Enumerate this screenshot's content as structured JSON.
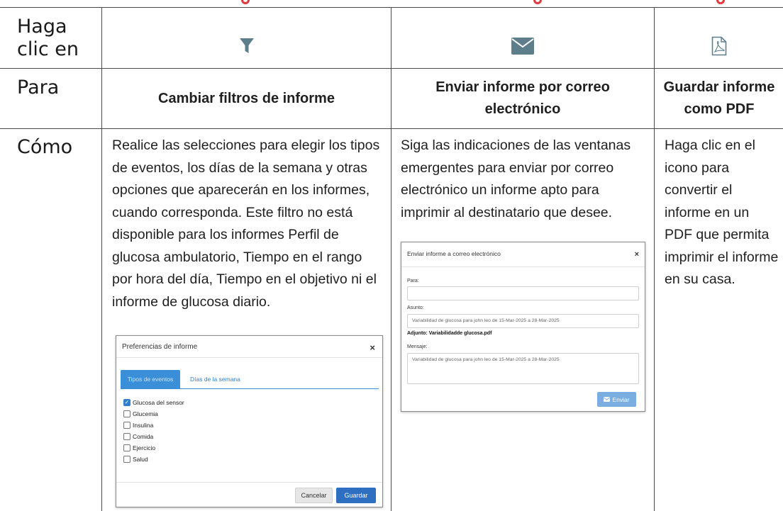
{
  "rows": {
    "click": "Haga clic en",
    "purpose": "Para",
    "how": "Cómo"
  },
  "icons": {
    "col1": "filter-icon",
    "col2": "envelope-icon",
    "col3": "pdf-file-icon",
    "color": "#5f7e8c",
    "accent": "#e03a3e"
  },
  "purposes": {
    "col1": "Cambiar filtros de informe",
    "col2": "Enviar informe por correo electrónico",
    "col3": "Guardar informe como PDF"
  },
  "howto": {
    "col1": "Realice las selecciones para elegir los tipos de eventos, los días de la semana y otras opciones que aparecerán en los informes, cuando corresponda. Este filtro no está disponible para los informes Perfil de glucosa ambulatorio, Tiempo en el rango por hora del día, Tiempo en el objetivo ni el informe de glucosa diario.",
    "col2": "Siga las indicaciones de las ventanas emergentes para enviar por correo electrónico un informe apto para imprimir al destinatario que desee.",
    "col3": "Haga clic en el icono para convertir el informe en un PDF que permita imprimir el informe en su casa."
  },
  "prefs_dialog": {
    "title": "Preferencias de informe",
    "close": "×",
    "tab_active": "Tipos de eventos",
    "tab_other": "Días de la semana",
    "options": [
      {
        "label": "Glucosa del sensor",
        "checked": true
      },
      {
        "label": "Glucemia",
        "checked": false
      },
      {
        "label": "Insulina",
        "checked": false
      },
      {
        "label": "Comida",
        "checked": false
      },
      {
        "label": "Ejercicio",
        "checked": false
      },
      {
        "label": "Salud",
        "checked": false
      }
    ],
    "cancel": "Cancelar",
    "save": "Guardar"
  },
  "email_dialog": {
    "title": "Enviar informe a correo electrónico",
    "close": "×",
    "to_label": "Para:",
    "to_value": "",
    "subject_label": "Asunto:",
    "subject_value": "Variabilidad de glucosa para john leo de 15-Mar-2025 a 28-Mar-2025",
    "attachment": "Adjunto: Variabilidadde glucosa.pdf",
    "message_label": "Mensaje:",
    "message_value": "Variabilidad de glucosa para john leo de 15-Mar-2025 a 28-Mar-2025",
    "send": "Enviar"
  }
}
